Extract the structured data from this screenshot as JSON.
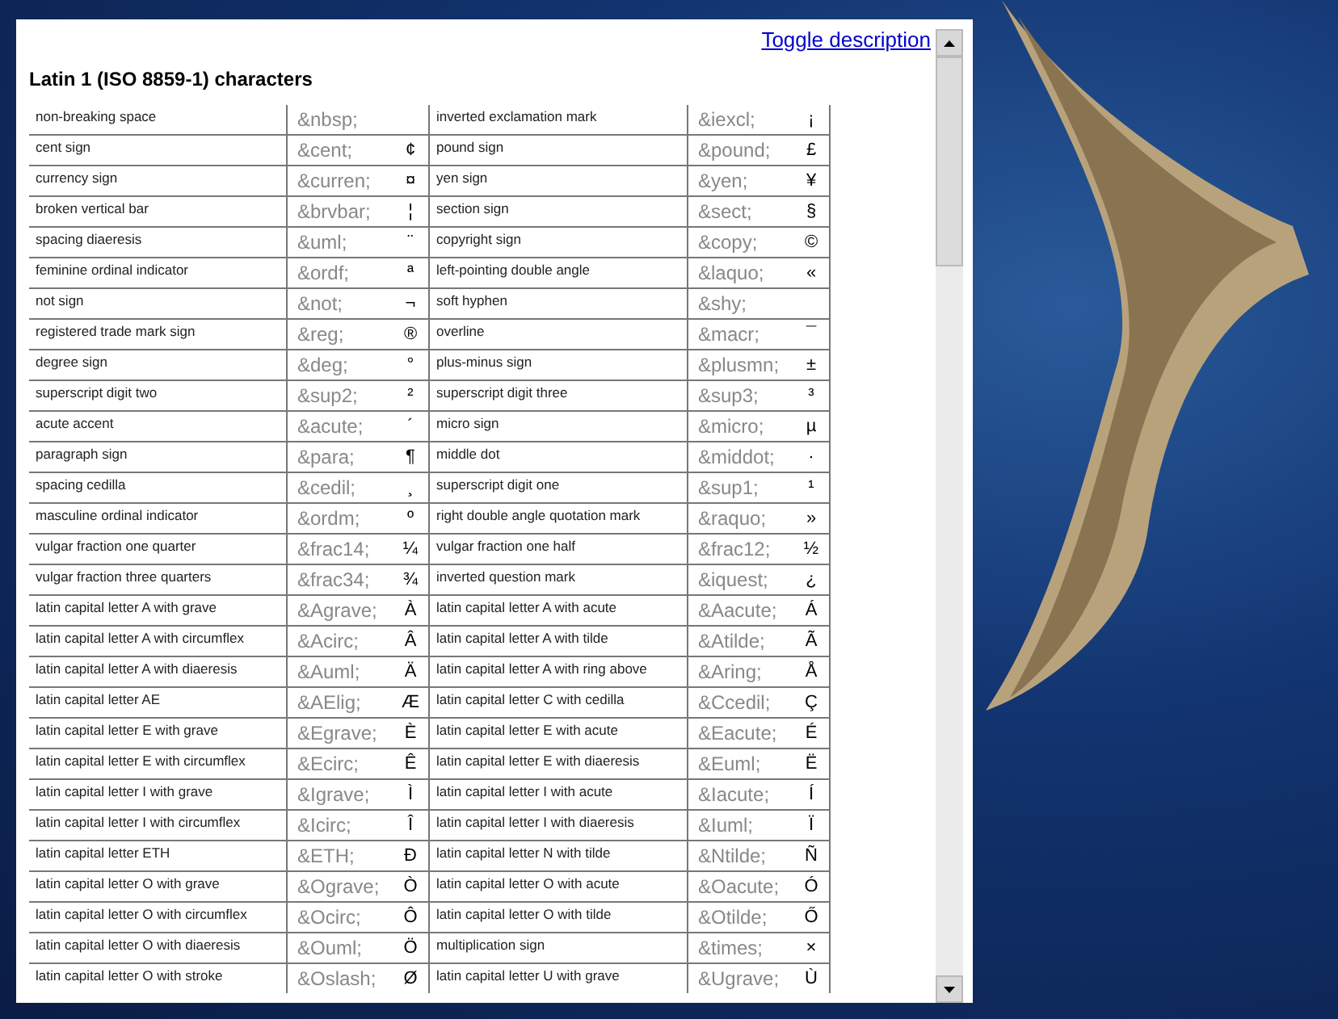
{
  "toggle_link": "Toggle description",
  "title": "Latin 1 (ISO 8859-1) characters",
  "rows": [
    [
      {
        "name": "non-breaking space",
        "entity": "&nbsp;"
      },
      {
        "name": "inverted exclamation mark",
        "entity": "&iexcl;",
        "char": "¡"
      }
    ],
    [
      {
        "name": "cent sign",
        "entity": "&cent;",
        "char": "¢"
      },
      {
        "name": "pound sign",
        "entity": "&pound;",
        "char": "£"
      }
    ],
    [
      {
        "name": "currency sign",
        "entity": "&curren;",
        "char": "¤"
      },
      {
        "name": "yen sign",
        "entity": "&yen;",
        "char": "¥"
      }
    ],
    [
      {
        "name": "broken vertical bar",
        "entity": "&brvbar;",
        "char": "¦"
      },
      {
        "name": "section sign",
        "entity": "&sect;",
        "char": "§"
      }
    ],
    [
      {
        "name": "spacing diaeresis",
        "entity": "&uml;",
        "char": "¨"
      },
      {
        "name": "copyright sign",
        "entity": "&copy;",
        "char": "©"
      }
    ],
    [
      {
        "name": "feminine ordinal indicator",
        "entity": "&ordf;",
        "char": "ª"
      },
      {
        "name": "left-pointing double angle",
        "entity": "&laquo;",
        "char": "«"
      }
    ],
    [
      {
        "name": "not sign",
        "entity": "&not;",
        "char": "¬"
      },
      {
        "name": "soft hyphen",
        "entity": "&shy;"
      }
    ],
    [
      {
        "name": "registered trade mark sign",
        "entity": "&reg;",
        "char": "®"
      },
      {
        "name": "overline",
        "entity": "&macr;",
        "char": "¯"
      }
    ],
    [
      {
        "name": "degree sign",
        "entity": "&deg;",
        "char": "°"
      },
      {
        "name": "plus-minus sign",
        "entity": "&plusmn;",
        "char": "±"
      }
    ],
    [
      {
        "name": "superscript digit two",
        "entity": "&sup2;",
        "char": "²"
      },
      {
        "name": "superscript digit three",
        "entity": "&sup3;",
        "char": "³"
      }
    ],
    [
      {
        "name": "acute accent",
        "entity": "&acute;",
        "char": "´"
      },
      {
        "name": "micro sign",
        "entity": "&micro;",
        "char": "µ"
      }
    ],
    [
      {
        "name": "paragraph sign",
        "entity": "&para;",
        "char": "¶"
      },
      {
        "name": "middle dot",
        "entity": "&middot;",
        "char": "·"
      }
    ],
    [
      {
        "name": "spacing cedilla",
        "entity": "&cedil;",
        "char": "¸"
      },
      {
        "name": "superscript digit one",
        "entity": "&sup1;",
        "char": "¹"
      }
    ],
    [
      {
        "name": "masculine ordinal indicator",
        "entity": "&ordm;",
        "char": "º"
      },
      {
        "name": "right double angle quotation mark",
        "entity": "&raquo;",
        "char": "»"
      }
    ],
    [
      {
        "name": "vulgar fraction one quarter",
        "entity": "&frac14;",
        "char": "¼"
      },
      {
        "name": "vulgar fraction one half",
        "entity": "&frac12;",
        "char": "½"
      }
    ],
    [
      {
        "name": "vulgar fraction three quarters",
        "entity": "&frac34;",
        "char": "¾"
      },
      {
        "name": "inverted question mark",
        "entity": "&iquest;",
        "char": "¿"
      }
    ],
    [
      {
        "name": "latin capital letter A with grave",
        "entity": "&Agrave;",
        "char": "À"
      },
      {
        "name": "latin capital letter A with acute",
        "entity": "&Aacute;",
        "char": "Á"
      }
    ],
    [
      {
        "name": "latin capital letter A with circumflex",
        "entity": "&Acirc;",
        "char": "Â"
      },
      {
        "name": "latin capital letter A with tilde",
        "entity": "&Atilde;",
        "char": "Ã"
      }
    ],
    [
      {
        "name": "latin capital letter A with diaeresis",
        "entity": "&Auml;",
        "char": "Ä"
      },
      {
        "name": "latin capital letter A with ring above",
        "entity": "&Aring;",
        "char": "Å"
      }
    ],
    [
      {
        "name": "latin capital letter AE",
        "entity": "&AElig;",
        "char": "Æ"
      },
      {
        "name": "latin capital letter C with cedilla",
        "entity": "&Ccedil;",
        "char": "Ç"
      }
    ],
    [
      {
        "name": "latin capital letter E with grave",
        "entity": "&Egrave;",
        "char": "È"
      },
      {
        "name": "latin capital letter E with acute",
        "entity": "&Eacute;",
        "char": "É"
      }
    ],
    [
      {
        "name": "latin capital letter E with circumflex",
        "entity": "&Ecirc;",
        "char": "Ê"
      },
      {
        "name": "latin capital letter E with diaeresis",
        "entity": "&Euml;",
        "char": "Ë"
      }
    ],
    [
      {
        "name": "latin capital letter I with grave",
        "entity": "&Igrave;",
        "char": "Ì"
      },
      {
        "name": "latin capital letter I with acute",
        "entity": "&Iacute;",
        "char": "Í"
      }
    ],
    [
      {
        "name": "latin capital letter I with circumflex",
        "entity": "&Icirc;",
        "char": "Î"
      },
      {
        "name": "latin capital letter I with diaeresis",
        "entity": "&Iuml;",
        "char": "Ï"
      }
    ],
    [
      {
        "name": "latin capital letter ETH",
        "entity": "&ETH;",
        "char": "Ð"
      },
      {
        "name": "latin capital letter N with tilde",
        "entity": "&Ntilde;",
        "char": "Ñ"
      }
    ],
    [
      {
        "name": "latin capital letter O with grave",
        "entity": "&Ograve;",
        "char": "Ò"
      },
      {
        "name": "latin capital letter O with acute",
        "entity": "&Oacute;",
        "char": "Ó"
      }
    ],
    [
      {
        "name": "latin capital letter O with circumflex",
        "entity": "&Ocirc;",
        "char": "Ô"
      },
      {
        "name": "latin capital letter O with tilde",
        "entity": "&Otilde;",
        "char": "Ő"
      }
    ],
    [
      {
        "name": "latin capital letter O with diaeresis",
        "entity": "&Ouml;",
        "char": "Ö"
      },
      {
        "name": "multiplication sign",
        "entity": "&times;",
        "char": "×"
      }
    ],
    [
      {
        "name": "latin capital letter O with stroke",
        "entity": "&Oslash;",
        "char": "Ø"
      },
      {
        "name": "latin capital letter U with grave",
        "entity": "&Ugrave;",
        "char": "Ù"
      }
    ]
  ]
}
